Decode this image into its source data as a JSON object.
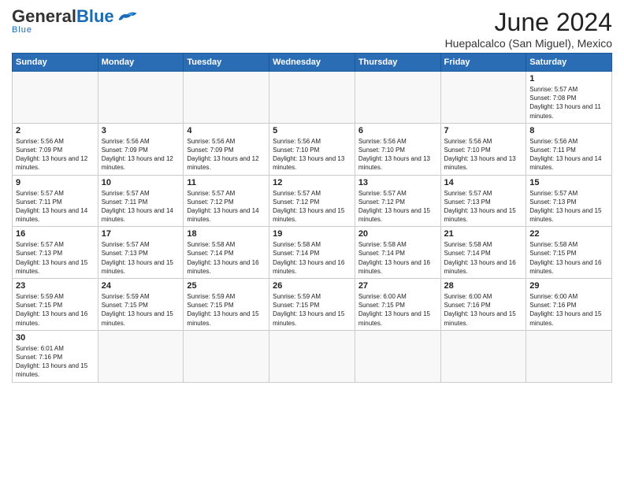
{
  "header": {
    "logo": {
      "general": "General",
      "blue": "Blue",
      "tagline": "Blue"
    },
    "title": "June 2024",
    "location": "Huepalcalco (San Miguel), Mexico"
  },
  "weekdays": [
    "Sunday",
    "Monday",
    "Tuesday",
    "Wednesday",
    "Thursday",
    "Friday",
    "Saturday"
  ],
  "weeks": [
    [
      {
        "day": "",
        "empty": true
      },
      {
        "day": "",
        "empty": true
      },
      {
        "day": "",
        "empty": true
      },
      {
        "day": "",
        "empty": true
      },
      {
        "day": "",
        "empty": true
      },
      {
        "day": "",
        "empty": true
      },
      {
        "day": "1",
        "sunrise": "5:57 AM",
        "sunset": "7:08 PM",
        "daylight": "13 hours and 11 minutes."
      }
    ],
    [
      {
        "day": "2",
        "sunrise": "5:56 AM",
        "sunset": "7:09 PM",
        "daylight": "13 hours and 12 minutes."
      },
      {
        "day": "3",
        "sunrise": "5:56 AM",
        "sunset": "7:09 PM",
        "daylight": "13 hours and 12 minutes."
      },
      {
        "day": "4",
        "sunrise": "5:56 AM",
        "sunset": "7:09 PM",
        "daylight": "13 hours and 12 minutes."
      },
      {
        "day": "5",
        "sunrise": "5:56 AM",
        "sunset": "7:10 PM",
        "daylight": "13 hours and 13 minutes."
      },
      {
        "day": "6",
        "sunrise": "5:56 AM",
        "sunset": "7:10 PM",
        "daylight": "13 hours and 13 minutes."
      },
      {
        "day": "7",
        "sunrise": "5:56 AM",
        "sunset": "7:10 PM",
        "daylight": "13 hours and 13 minutes."
      },
      {
        "day": "8",
        "sunrise": "5:56 AM",
        "sunset": "7:11 PM",
        "daylight": "13 hours and 14 minutes."
      }
    ],
    [
      {
        "day": "9",
        "sunrise": "5:57 AM",
        "sunset": "7:11 PM",
        "daylight": "13 hours and 14 minutes."
      },
      {
        "day": "10",
        "sunrise": "5:57 AM",
        "sunset": "7:11 PM",
        "daylight": "13 hours and 14 minutes."
      },
      {
        "day": "11",
        "sunrise": "5:57 AM",
        "sunset": "7:12 PM",
        "daylight": "13 hours and 14 minutes."
      },
      {
        "day": "12",
        "sunrise": "5:57 AM",
        "sunset": "7:12 PM",
        "daylight": "13 hours and 15 minutes."
      },
      {
        "day": "13",
        "sunrise": "5:57 AM",
        "sunset": "7:12 PM",
        "daylight": "13 hours and 15 minutes."
      },
      {
        "day": "14",
        "sunrise": "5:57 AM",
        "sunset": "7:13 PM",
        "daylight": "13 hours and 15 minutes."
      },
      {
        "day": "15",
        "sunrise": "5:57 AM",
        "sunset": "7:13 PM",
        "daylight": "13 hours and 15 minutes."
      }
    ],
    [
      {
        "day": "16",
        "sunrise": "5:57 AM",
        "sunset": "7:13 PM",
        "daylight": "13 hours and 15 minutes."
      },
      {
        "day": "17",
        "sunrise": "5:57 AM",
        "sunset": "7:13 PM",
        "daylight": "13 hours and 15 minutes."
      },
      {
        "day": "18",
        "sunrise": "5:58 AM",
        "sunset": "7:14 PM",
        "daylight": "13 hours and 16 minutes."
      },
      {
        "day": "19",
        "sunrise": "5:58 AM",
        "sunset": "7:14 PM",
        "daylight": "13 hours and 16 minutes."
      },
      {
        "day": "20",
        "sunrise": "5:58 AM",
        "sunset": "7:14 PM",
        "daylight": "13 hours and 16 minutes."
      },
      {
        "day": "21",
        "sunrise": "5:58 AM",
        "sunset": "7:14 PM",
        "daylight": "13 hours and 16 minutes."
      },
      {
        "day": "22",
        "sunrise": "5:58 AM",
        "sunset": "7:15 PM",
        "daylight": "13 hours and 16 minutes."
      }
    ],
    [
      {
        "day": "23",
        "sunrise": "5:59 AM",
        "sunset": "7:15 PM",
        "daylight": "13 hours and 16 minutes."
      },
      {
        "day": "24",
        "sunrise": "5:59 AM",
        "sunset": "7:15 PM",
        "daylight": "13 hours and 15 minutes."
      },
      {
        "day": "25",
        "sunrise": "5:59 AM",
        "sunset": "7:15 PM",
        "daylight": "13 hours and 15 minutes."
      },
      {
        "day": "26",
        "sunrise": "5:59 AM",
        "sunset": "7:15 PM",
        "daylight": "13 hours and 15 minutes."
      },
      {
        "day": "27",
        "sunrise": "6:00 AM",
        "sunset": "7:15 PM",
        "daylight": "13 hours and 15 minutes."
      },
      {
        "day": "28",
        "sunrise": "6:00 AM",
        "sunset": "7:16 PM",
        "daylight": "13 hours and 15 minutes."
      },
      {
        "day": "29",
        "sunrise": "6:00 AM",
        "sunset": "7:16 PM",
        "daylight": "13 hours and 15 minutes."
      }
    ],
    [
      {
        "day": "30",
        "sunrise": "6:01 AM",
        "sunset": "7:16 PM",
        "daylight": "13 hours and 15 minutes."
      },
      {
        "day": "",
        "empty": true
      },
      {
        "day": "",
        "empty": true
      },
      {
        "day": "",
        "empty": true
      },
      {
        "day": "",
        "empty": true
      },
      {
        "day": "",
        "empty": true
      },
      {
        "day": "",
        "empty": true
      }
    ]
  ]
}
